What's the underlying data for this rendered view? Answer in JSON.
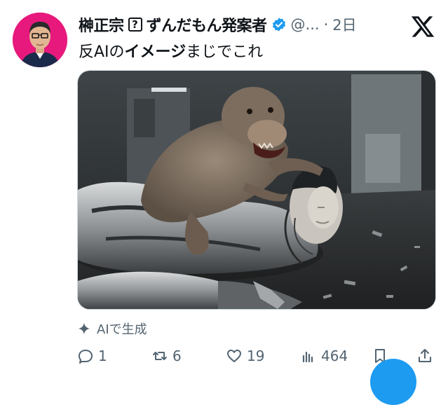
{
  "post": {
    "author_name": "榊正宗",
    "badge_char": "?",
    "author_name_suffix": "ずんだもん発案者",
    "handle": "@...",
    "separator": "·",
    "timestamp": "2日",
    "text_prefix": "反AIの",
    "text_bold": "イメージ",
    "text_suffix": "まじでこれ"
  },
  "media": {
    "ai_label": "AIで生成"
  },
  "actions": {
    "replies": "1",
    "reposts": "6",
    "likes": "19",
    "views": "464"
  },
  "colors": {
    "avatar_bg": "#e8197d",
    "verified": "#1d9bf0",
    "secondary_text": "#536471",
    "fab": "#1d9bf0"
  },
  "icons": [
    "x-logo-icon",
    "verified-badge-icon",
    "sparkle-icon",
    "reply-icon",
    "repost-icon",
    "like-icon",
    "views-icon",
    "bookmark-icon",
    "share-icon"
  ]
}
